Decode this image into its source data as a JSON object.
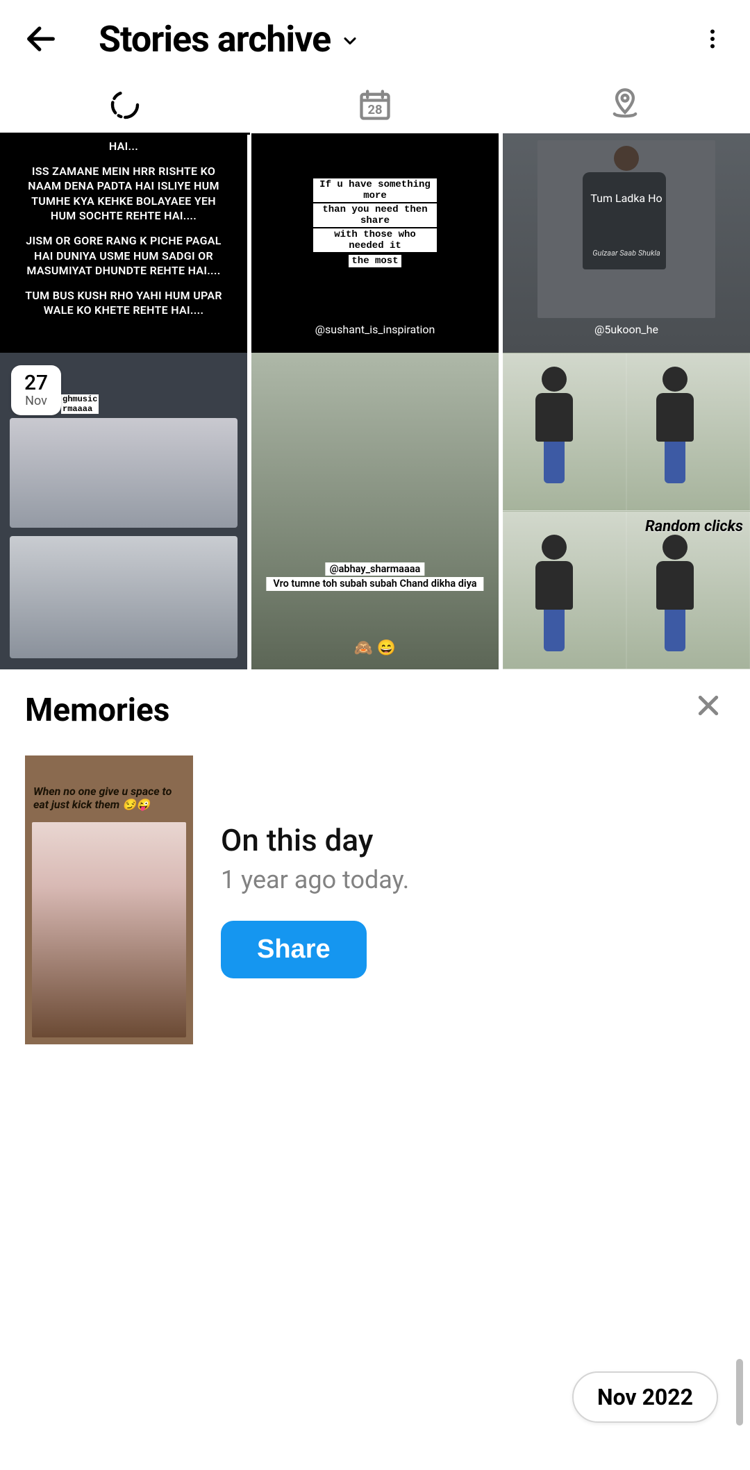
{
  "header": {
    "title": "Stories archive"
  },
  "tabs": {
    "calendar_day": "28"
  },
  "stories": {
    "tile1": {
      "line0": "HAI...",
      "para1": "ISS ZAMANE MEIN HRR RISHTE KO NAAM DENA PADTA HAI  ISLIYE HUM TUMHE KYA KEHKE BOLAYAEE YEH HUM SOCHTE REHTE HAI....",
      "para2": "JISM OR GORE RANG K PICHE PAGAL HAI DUNIYA USME HUM SADGI OR MASUMIYAT DHUNDTE REHTE HAI....",
      "para3": "TUM BUS KUSH RHO YAHI HUM UPAR WALE KO KHETE REHTE HAI...."
    },
    "tile2": {
      "l1": "If u have something more",
      "l2": "than you need then share",
      "l3": "with those who needed it",
      "l4": "the most",
      "credit": "@sushant_is_inspiration"
    },
    "tile3": {
      "caption": "Tum Ladka Ho",
      "credit": "@5ukoon_he"
    },
    "tile4": {
      "day": "27",
      "month": "Nov",
      "tag1": "ghmusic",
      "tag2": "rmaaaa"
    },
    "tile5": {
      "handle": "@abhay_sharmaaaa",
      "msg": "Vro tumne toh subah subah Chand dikha diya",
      "emoji": "🙈 😄"
    },
    "tile6": {
      "label": "Random clicks"
    }
  },
  "memories": {
    "heading": "Memories",
    "thumb_caption": "When no one give u space to eat just kick them 😏😜",
    "title": "On this day",
    "subtitle": "1 year ago today.",
    "share": "Share"
  },
  "pill": "Nov 2022"
}
